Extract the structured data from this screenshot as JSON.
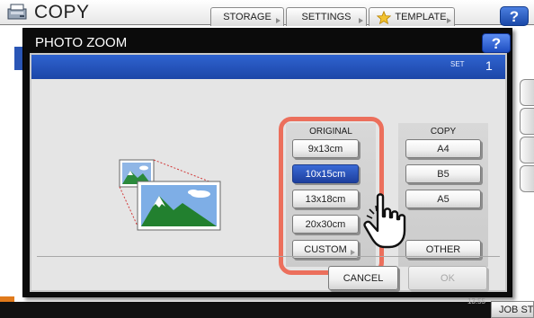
{
  "app": {
    "title": "COPY",
    "tabs": [
      {
        "label": "STORAGE"
      },
      {
        "label": "SETTINGS"
      },
      {
        "label": "TEMPLATE"
      }
    ],
    "help_label": "?",
    "status_time": "13:55",
    "job_status_label": "JOB STATUS"
  },
  "dialog": {
    "title": "PHOTO ZOOM",
    "help_label": "?",
    "set_label": "SET",
    "set_value": "1",
    "original": {
      "heading": "ORIGINAL",
      "options": [
        {
          "label": "9x13cm",
          "selected": false
        },
        {
          "label": "10x15cm",
          "selected": true
        },
        {
          "label": "13x18cm",
          "selected": false
        },
        {
          "label": "20x30cm",
          "selected": false
        },
        {
          "label": "CUSTOM",
          "selected": false
        }
      ]
    },
    "copy": {
      "heading": "COPY",
      "options": [
        {
          "label": "A4"
        },
        {
          "label": "B5"
        },
        {
          "label": "A5"
        },
        {
          "label": "OTHER"
        }
      ]
    },
    "cancel_label": "CANCEL",
    "ok_label": "OK",
    "ok_enabled": false
  },
  "colors": {
    "accent_blue": "#1d46a8",
    "selected_button": "#2a55c0",
    "highlight_orange": "#ec6f5c"
  },
  "icons": [
    "copy-app-icon",
    "star-icon",
    "photo-zoom-illustration",
    "pointing-hand-icon"
  ]
}
